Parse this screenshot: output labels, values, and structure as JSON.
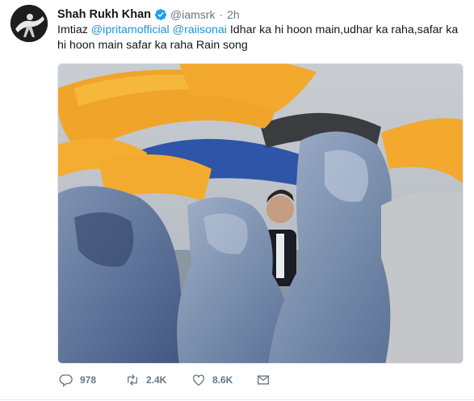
{
  "tweet": {
    "author_name": "Shah Rukh Khan",
    "handle": "@iamsrk",
    "separator": "·",
    "time": "2h",
    "text_before": "Imtiaz ",
    "mention_1": "@ipritamofficial",
    "mention_2": "@raiisonai",
    "text_after": " Idhar ka hi hoon main,udhar ka raha,safar ka hi hoon main safar ka raha Rain song"
  },
  "actions": {
    "replies": "978",
    "retweets": "2.4K",
    "likes": "8.6K"
  },
  "icons": {
    "verified": "verified-badge-icon",
    "reply": "reply-icon",
    "retweet": "retweet-icon",
    "like": "heart-icon",
    "dm": "envelope-icon"
  },
  "colors": {
    "link": "#1b95e0",
    "muted": "#657786",
    "verified": "#1da1f2"
  }
}
